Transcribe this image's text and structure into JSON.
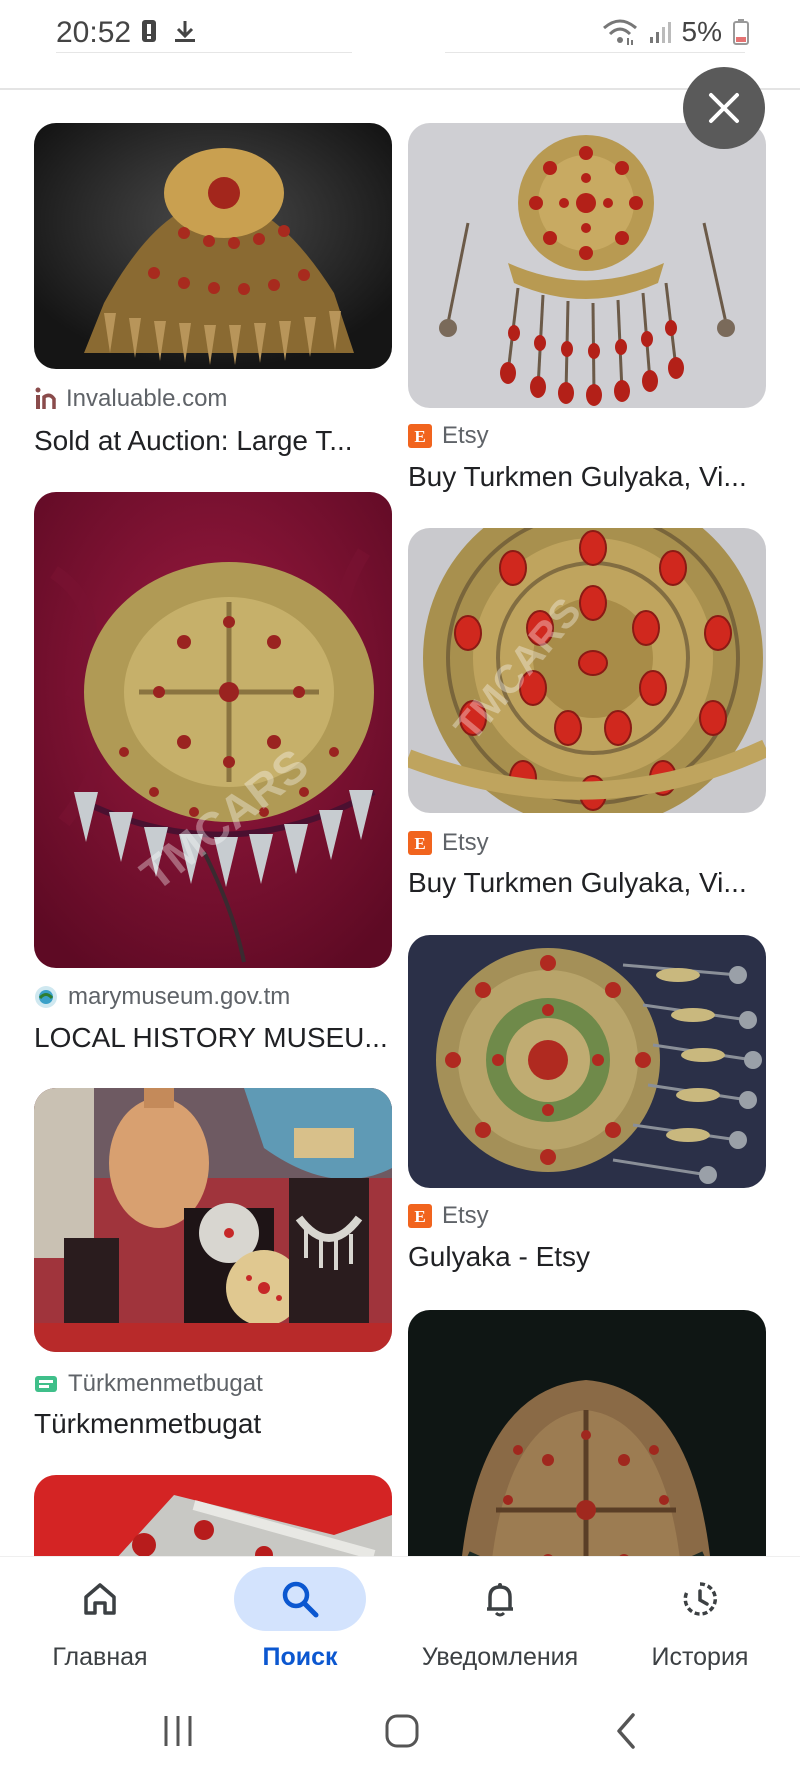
{
  "status_bar": {
    "time": "20:52",
    "battery": "5%",
    "icons": [
      "alert-battery-icon",
      "download-icon",
      "wifi-icon",
      "signal-icon",
      "battery-icon"
    ]
  },
  "close_icon": "close-icon",
  "results": {
    "left": [
      {
        "source": "Invaluable.com",
        "source_icon": "invaluable-favicon-icon",
        "title": "Sold at Auction: Large T..."
      },
      {
        "source": "marymuseum.gov.tm",
        "source_icon": "marymuseum-favicon-icon",
        "title": "LOCAL HISTORY MUSEU..."
      },
      {
        "source": "Türkmenmetbugat",
        "source_icon": "turkmenmetbugat-favicon-icon",
        "title": "Türkmenmetbugat"
      }
    ],
    "right": [
      {
        "source": "Etsy",
        "source_icon": "etsy-favicon-icon",
        "title": "Buy Turkmen Gulyaka, Vi..."
      },
      {
        "source": "Etsy",
        "source_icon": "etsy-favicon-icon",
        "title": "Buy Turkmen Gulyaka, Vi..."
      },
      {
        "source": "Etsy",
        "source_icon": "etsy-favicon-icon",
        "title": "Gulyaka - Etsy"
      }
    ],
    "watermark": "TMCARS"
  },
  "bottom_nav": {
    "items": [
      {
        "label": "Главная",
        "icon": "home-icon",
        "active": false
      },
      {
        "label": "Поиск",
        "icon": "search-icon",
        "active": true
      },
      {
        "label": "Уведомления",
        "icon": "bell-icon",
        "active": false
      },
      {
        "label": "История",
        "icon": "history-icon",
        "active": false
      }
    ]
  },
  "system_nav": {
    "icons": [
      "recents-icon",
      "home-circle-icon",
      "back-icon"
    ]
  },
  "colors": {
    "accent": "#0b57d0",
    "active_pill": "#d3e3fd",
    "etsy": "#f1641e",
    "close_bg": "#5a5a5a"
  }
}
